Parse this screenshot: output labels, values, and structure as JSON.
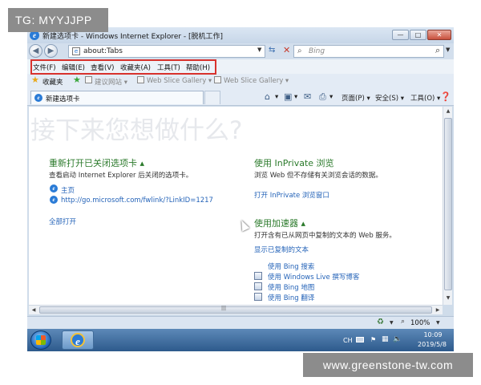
{
  "watermarks": {
    "top_left": "TG: MYYJJPP",
    "bottom_right": "www.greenstone-tw.com"
  },
  "window": {
    "title": "新建选项卡 - Windows Internet Explorer - [脱机工作]",
    "minimize_glyph": "—",
    "maximize_glyph": "□",
    "close_glyph": "✕"
  },
  "address_bar": {
    "url": "about:Tabs",
    "search_placeholder": "Bing"
  },
  "menu": {
    "items": [
      "文件(F)",
      "编辑(E)",
      "查看(V)",
      "收藏夹(A)",
      "工具(T)",
      "帮助(H)"
    ],
    "highlight_color": "#d8322d"
  },
  "favorites_bar": {
    "label": "收藏夹",
    "links": [
      "建议网站 ▾",
      "Web Slice Gallery ▾",
      "Web Slice Gallery ▾"
    ]
  },
  "tab": {
    "label": "新建选项卡"
  },
  "command_bar": {
    "page": "页面(P) ▾",
    "safety": "安全(S) ▾",
    "tools": "工具(O) ▾"
  },
  "content": {
    "heading": "接下来您想做什么?",
    "reopen": {
      "title": "重新打开已关闭选项卡 ▴",
      "desc": "查看启动 Internet Explorer 后关闭的选项卡。",
      "links": [
        "主页",
        "http://go.microsoft.com/fwlink/?LinkID=1217"
      ],
      "open_all": "全部打开"
    },
    "inprivate": {
      "title": "使用 InPrivate 浏览",
      "desc": "浏览 Web 但不存储有关浏览会话的数据。",
      "link": "打开 InPrivate 浏览窗口"
    },
    "accelerators": {
      "title": "使用加速器 ▴",
      "desc": "打开含有已从网页中复制的文本的 Web 服务。",
      "show_copied": "显示已复制的文本",
      "items": [
        "使用 Bing 搜索",
        "使用 Windows Live 撰写博客",
        "使用 Bing 地图",
        "使用 Bing 翻译"
      ]
    },
    "accent_title_color": "#2b7a2b",
    "link_color": "#2463b8"
  },
  "status_bar": {
    "zoom": "100%"
  },
  "taskbar": {
    "lang": "CH",
    "time": "10:09",
    "date": "2019/5/8"
  }
}
